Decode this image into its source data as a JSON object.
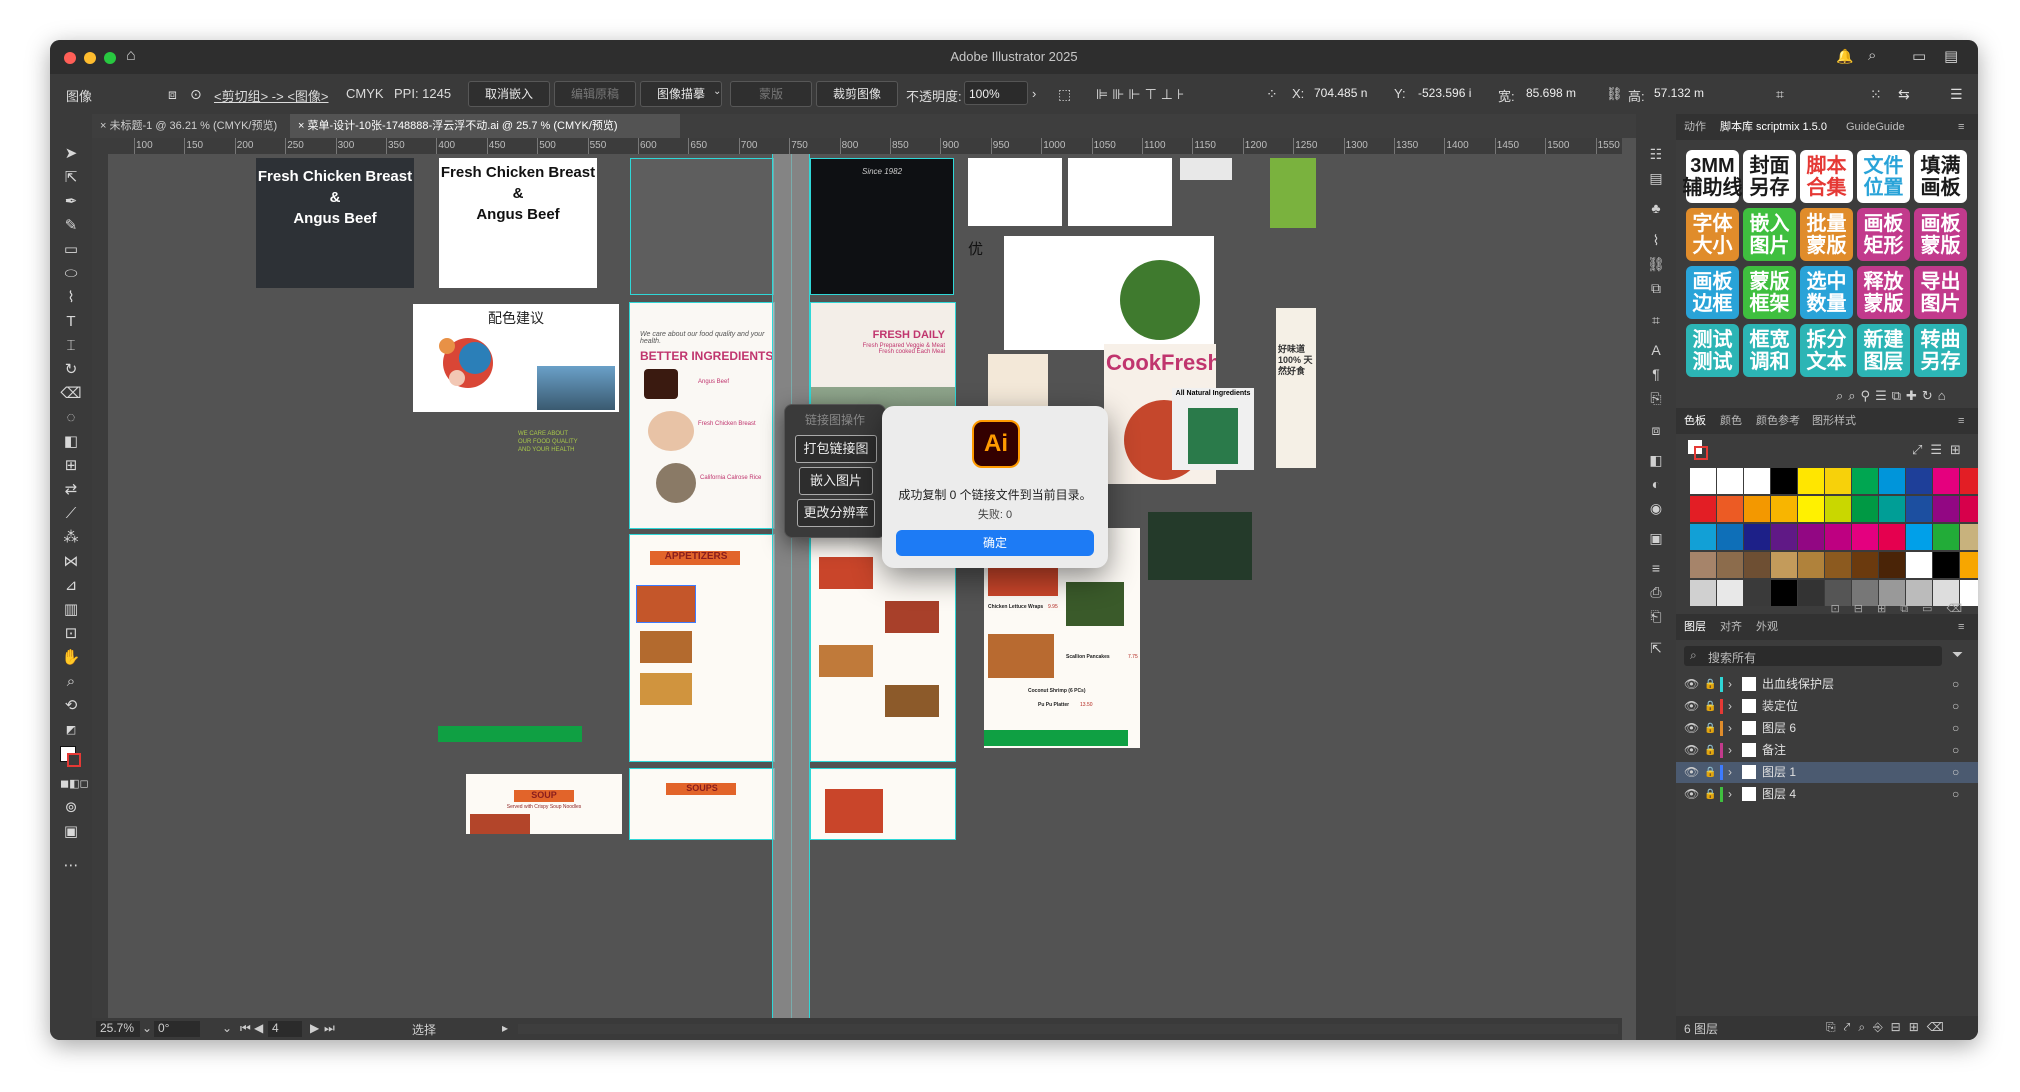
{
  "app": {
    "title": "Adobe Illustrator 2025"
  },
  "control_bar": {
    "selection_type": "图像",
    "breadcrumb": "<剪切组> -> <图像>",
    "color_mode": "CMYK",
    "ppi": "PPI: 1245",
    "unembed_button": "取消嵌入",
    "edit_original_button": "编辑原稿",
    "image_trace_button": "图像描摹",
    "mask_button": "蒙版",
    "crop_button": "裁剪图像",
    "opacity_label": "不透明度:",
    "opacity_value": "100%",
    "x_label": "X:",
    "x_value": "704.485 n",
    "y_label": "Y:",
    "y_value": "-523.596 i",
    "w_label": "宽:",
    "w_value": "85.698 m",
    "h_label": "高:",
    "h_value": "57.132 m"
  },
  "doc_tabs": [
    {
      "label": "未标题-1 @ 36.21 % (CMYK/预览)",
      "active": false
    },
    {
      "label": "菜单-设计-10张-1748888-浮云浮不动.ai @ 25.7 % (CMYK/预览)",
      "active": true
    }
  ],
  "ruler_ticks": [
    "100",
    "150",
    "200",
    "250",
    "300",
    "350",
    "400",
    "450",
    "500",
    "550",
    "600",
    "650",
    "700",
    "750",
    "800",
    "850",
    "900",
    "950",
    "1000",
    "1050",
    "1100",
    "1150",
    "1200",
    "1250",
    "1300",
    "1350",
    "1400",
    "1450",
    "1500",
    "1550"
  ],
  "canvas": {
    "card1_title": "Fresh Chicken Breast",
    "card1_amp": "&",
    "card1_title2": "Angus Beef",
    "card2_title": "Fresh Chicken Breast",
    "card2_amp": "&",
    "card2_title2": "Angus Beef",
    "color_suggestion": "配色建议",
    "better_tagline": "We care about our food quality and your health.",
    "better_ingredients": "BETTER INGREDIENTS",
    "fresh_daily": "FRESH DAILY",
    "fresh_daily_sub": "Fresh Prepared Veggie & Meat",
    "fresh_daily_sub2": "Fresh cooked Each Meal",
    "angus_beef": "Angus Beef",
    "fresh_chicken_breast": "Fresh Chicken Breast",
    "california_calrose": "California Calrose Rice",
    "appetizers": "APPETIZERS",
    "soup": "SOUP",
    "soup_sub": "Served with Crispy Soup Noodles",
    "soups": "SOUPS",
    "cookfresh": "CookFresh",
    "all_natural": "All Natural Ingredients",
    "since": "Since 1982",
    "green_text": "WE CARE ABOUT OUR FOOD QUALITY AND YOUR HEALTH",
    "side_cn_text": "好味道 100% 天然好食",
    "lettuce_wraps": "Chicken Lettuce Wraps",
    "scallion_pancakes": "Scallion Pancakes",
    "coconut_shrimp": "Coconut Shrimp (6 PCs)",
    "pu_pu_platter": "Pu Pu Platter",
    "price_1": "9.95",
    "price_2": "7.75",
    "price_3": "13.50"
  },
  "link_panel": {
    "title": "链接图操作",
    "pack_button": "打包链接图",
    "embed_button": "嵌入图片",
    "resolution_button": "更改分辨率"
  },
  "alert": {
    "icon_text": "Ai",
    "message": "成功复制 0 个链接文件到当前目录。",
    "failed": "失败: 0",
    "ok_button": "确定"
  },
  "status_bar": {
    "zoom": "25.7%",
    "rotation": "0°",
    "artboard": "4",
    "mode": "选择"
  },
  "script_panel": {
    "tabs": [
      "动作",
      "脚本库 scriptmix 1.5.0",
      "GuideGuide"
    ],
    "buttons": [
      {
        "label": "3MM\n辅助线",
        "color": "#ffffff",
        "fg": "#1a1a1a"
      },
      {
        "label": "封面\n另存",
        "color": "#ffffff",
        "fg": "#1a1a1a"
      },
      {
        "label": "脚本\n合集",
        "color": "#ffffff",
        "fg": "#e53935"
      },
      {
        "label": "文件\n位置",
        "color": "#ffffff",
        "fg": "#29a3d8"
      },
      {
        "label": "填满\n画板",
        "color": "#ffffff",
        "fg": "#1a1a1a"
      },
      {
        "label": "字体\n大小",
        "color": "#e08c2b",
        "fg": "#ffffff"
      },
      {
        "label": "嵌入\n图片",
        "color": "#3fbf3f",
        "fg": "#ffffff"
      },
      {
        "label": "批量\n蒙版",
        "color": "#e08c2b",
        "fg": "#ffffff"
      },
      {
        "label": "画板\n矩形",
        "color": "#c23a8c",
        "fg": "#ffffff"
      },
      {
        "label": "画板\n蒙版",
        "color": "#c23a8c",
        "fg": "#ffffff"
      },
      {
        "label": "画板\n边框",
        "color": "#29a3d8",
        "fg": "#ffffff"
      },
      {
        "label": "蒙版\n框架",
        "color": "#3fbf3f",
        "fg": "#ffffff"
      },
      {
        "label": "选中\n数量",
        "color": "#29a3d8",
        "fg": "#ffffff"
      },
      {
        "label": "释放\n蒙版",
        "color": "#c23a8c",
        "fg": "#ffffff"
      },
      {
        "label": "导出\n图片",
        "color": "#c23a8c",
        "fg": "#ffffff"
      },
      {
        "label": "测试\n测试",
        "color": "#2cb5b5",
        "fg": "#ffffff"
      },
      {
        "label": "框宽\n调和",
        "color": "#2cb5b5",
        "fg": "#ffffff"
      },
      {
        "label": "拆分\n文本",
        "color": "#2cb5b5",
        "fg": "#ffffff"
      },
      {
        "label": "新建\n图层",
        "color": "#2cb5b5",
        "fg": "#ffffff"
      },
      {
        "label": "转曲\n另存",
        "color": "#2cb5b5",
        "fg": "#ffffff"
      }
    ]
  },
  "swatches_panel": {
    "tabs": [
      "色板",
      "颜色",
      "颜色参考",
      "图形样式"
    ],
    "rows": [
      [
        "#ffffff",
        "#ffffff",
        "#ffffff",
        "#000000",
        "#ffe600",
        "#f7d10a",
        "#00a651",
        "#0095da",
        "#1e3f99",
        "#e5007e",
        "#e31e25"
      ],
      [
        "#e31e25",
        "#ec5b24",
        "#f39800",
        "#f8b500",
        "#fff100",
        "#c9d700",
        "#009944",
        "#009e96",
        "#1c4fa0",
        "#920783",
        "#d7004b"
      ],
      [
        "#12a0d6",
        "#0e6fb8",
        "#1d2088",
        "#601986",
        "#920783",
        "#be0081",
        "#e4007f",
        "#e5004f",
        "#00a0e9",
        "#22ac38",
        "#c8b27d"
      ],
      [
        "#a6846a",
        "#8c6c4c",
        "#6e4f33",
        "#c39b5b",
        "#b0823b",
        "#8c5a1f",
        "#6b3a0e",
        "#4a2407",
        "#ffffff",
        "#000000",
        "#f7a600"
      ],
      [
        "#d0d0d0",
        "#e8e8e8",
        "#3a3a3a",
        "#000000",
        "#333333",
        "#555555",
        "#777777",
        "#999999",
        "#bbbbbb",
        "#dddddd",
        "#ffffff"
      ]
    ]
  },
  "layers_panel": {
    "tabs": [
      "图层",
      "对齐",
      "外观"
    ],
    "search_placeholder": "搜索所有",
    "layers": [
      {
        "name": "出血线保护层",
        "color": "#2fd7d7",
        "selected": false
      },
      {
        "name": "装定位",
        "color": "#e53935",
        "selected": false
      },
      {
        "name": "图层 6",
        "color": "#e08c2b",
        "selected": false
      },
      {
        "name": "备注",
        "color": "#c23a8c",
        "selected": false
      },
      {
        "name": "图层 1",
        "color": "#3d7bff",
        "selected": true
      },
      {
        "name": "图层 4",
        "color": "#3fbf3f",
        "selected": false
      }
    ],
    "count": "6 图层"
  }
}
